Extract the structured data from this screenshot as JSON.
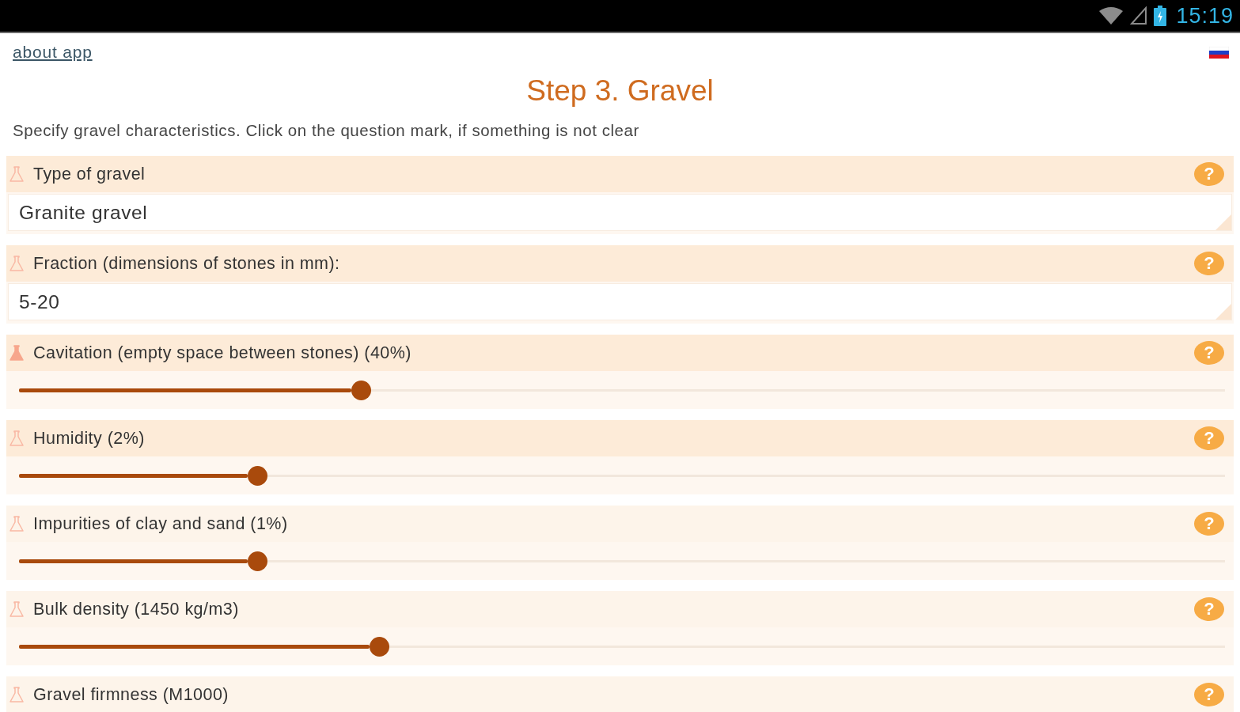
{
  "status_bar": {
    "time": "15:19"
  },
  "header": {
    "about_link": "about app"
  },
  "title": "Step 3. Gravel",
  "description": "Specify gravel characteristics. Click on the question mark, if something is not clear",
  "sections": [
    {
      "kind": "field",
      "label": "Type of gravel",
      "value": "Granite gravel",
      "help": "?",
      "focused": false,
      "highlighted": true
    },
    {
      "kind": "field",
      "label": "Fraction (dimensions of stones in mm):",
      "value": "5-20",
      "help": "?",
      "focused": false,
      "highlighted": true
    },
    {
      "kind": "slider",
      "label": "Cavitation (empty space between stones) (40%)",
      "level": 0.284,
      "help": "?",
      "focused": true,
      "highlighted": true
    },
    {
      "kind": "slider",
      "label": "Humidity (2%)",
      "level": 0.198,
      "help": "?",
      "focused": false,
      "highlighted": true
    },
    {
      "kind": "slider",
      "label": "Impurities of clay and sand (1%)",
      "level": 0.198,
      "help": "?",
      "focused": false,
      "highlighted": false
    },
    {
      "kind": "slider",
      "label": "Bulk density (1450 kg/m3)",
      "level": 0.299,
      "help": "?",
      "focused": false,
      "highlighted": false
    },
    {
      "kind": "heading",
      "label": "Gravel firmness (M1000)",
      "help": "?",
      "focused": false,
      "highlighted": false
    }
  ]
}
